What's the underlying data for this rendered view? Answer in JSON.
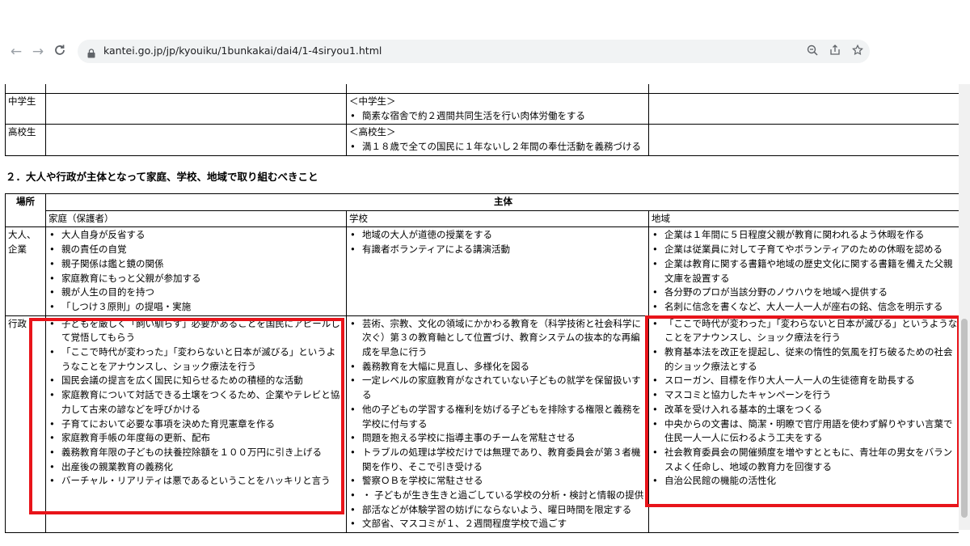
{
  "browser": {
    "url": "kantei.go.jp/jp/kyouiku/1bunkakai/dai4/1-4siryou1.html",
    "icons": {
      "back": "arrow-left-icon",
      "forward": "arrow-right-icon",
      "reload": "reload-icon",
      "lock": "lock-icon",
      "zoom": "zoom-icon",
      "share": "share-icon",
      "star": "star-icon"
    }
  },
  "table1": {
    "rows": [
      {
        "label": "",
        "col1": "",
        "col2": "",
        "col3": ""
      },
      {
        "label": "中学生",
        "col1": "",
        "col2_title": "＜中学生＞",
        "col2_items": [
          "簡素な宿舎で約２週間共同生活を行い肉体労働をする"
        ],
        "col3": ""
      },
      {
        "label": "高校生",
        "col1": "",
        "col2_title": "＜高校生＞",
        "col2_items": [
          "満１８歳で全ての国民に１年ないし２年間の奉仕活動を義務づける"
        ],
        "col3": ""
      }
    ]
  },
  "section2": {
    "heading": "２．大人や行政が主体となって家庭、学校、地域で取り組むべきこと",
    "header": {
      "place": "場所",
      "subject": "主体",
      "home": "家庭（保護者）",
      "school": "学校",
      "region": "地域"
    },
    "rows": [
      {
        "label": "大人、企業",
        "home": [
          "大人自身が反省する",
          "親の責任の自覚",
          "親子関係は鑑と鏡の関係",
          "家庭教育にもっと父親が参加する",
          "親が人生の目的を持つ",
          "「しつけ３原則」の提唱・実施"
        ],
        "school": [
          "地域の大人が道徳の授業をする",
          "有識者ボランティアによる講演活動"
        ],
        "region": [
          "企業は１年間に５日程度父親が教育に関われるよう休暇を作る",
          "企業は従業員に対して子育てやボランティアのための休暇を認める",
          "企業は教育に関する書籍や地域の歴史文化に関する書籍を備えた父親文庫を設置する",
          "各分野のプロが当該分野のノウハウを地域へ提供する",
          "名刺に信念を書くなど、大人一人一人が座右の銘、信念を明示する"
        ]
      },
      {
        "label": "行政",
        "home": [
          "子どもを厳しく「飼い馴らす」必要があることを国民にアピールして覚悟してもらう",
          "「ここで時代が変わった」「変わらないと日本が滅びる」というようなことをアナウンスし、ショック療法を行う",
          "国民会議の提言を広く国民に知らせるための積極的な活動",
          "家庭教育について対話できる土壌をつくるため、企業やテレビと協力して古来の諺などを呼びかける",
          "子育てにおいて必要な事項を決めた育児憲章を作る",
          "家庭教育手帳の年度毎の更新、配布",
          "義務教育年限の子どもの扶養控除額を１００万円に引き上げる",
          "出産後の親業教育の義務化",
          "バーチャル・リアリティは悪であるということをハッキリと言う"
        ],
        "school": [
          "芸術、宗教、文化の領域にかかわる教育を（科学技術と社会科学に次ぐ）第３の教育軸として位置づけ、教育システムの抜本的な再編成を早急に行う",
          "義務教育を大幅に見直し、多様化を図る",
          "一定レベルの家庭教育がなされていない子どもの就学を保留扱いする",
          "他の子どもの学習する権利を妨げる子どもを排除する権限と義務を学校に付与する",
          "問題を抱える学校に指導主事のチームを常駐させる",
          "トラブルの処理は学校だけでは無理であり、教育委員会が第３者機関を作り、そこで引き受ける",
          "警察ＯＢを学校に常駐させる",
          "・ 子どもが生き生きと過ごしている学校の分析・検討と情報の提供",
          "部活などが体験学習の妨げにならないよう、曜日時間を限定する",
          "文部省、マスコミが１、２週間程度学校で過ごす"
        ],
        "region": [
          "「ここで時代が変わった」「変わらないと日本が滅びる」というようなことをアナウンスし、ショック療法を行う",
          "教育基本法を改正を提起し、従来の惰性的気風を打ち破るための社会的ショック療法とする",
          "スローガン、目標を作り大人一人一人の生徒德育を助長する",
          "マスコミと協力したキャンペーンを行う",
          "改革を受け入れる基本的土壌をつくる",
          "中央からの文書は、簡潔・明瞭で官庁用語を使わず解りやすい言葉で住民一人一人に伝わるよう工夫をする",
          "社会教育委員会の開催頻度を増やすとともに、青壮年の男女をバランスよく任命し、地域の教育力を回復する",
          "自治公民館の機能の活性化"
        ]
      }
    ]
  },
  "annotations": {
    "highlight_color": "#e8141a"
  }
}
